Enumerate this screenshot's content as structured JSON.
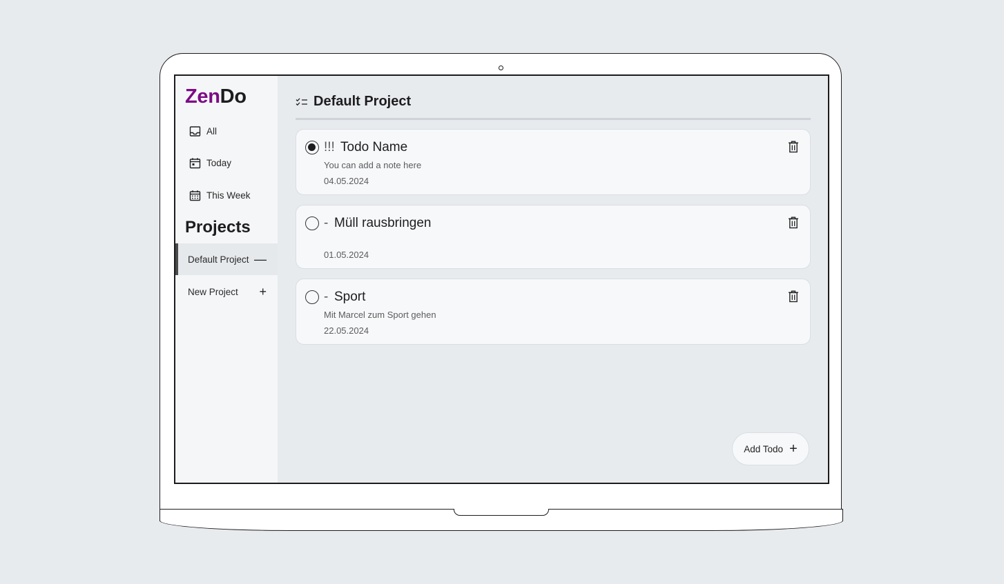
{
  "brand": {
    "part1": "Zen",
    "part2": "Do",
    "accent": "#7d0b86"
  },
  "nav": [
    {
      "label": "All",
      "icon": "inbox-icon"
    },
    {
      "label": "Today",
      "icon": "calendar-day-icon"
    },
    {
      "label": "This Week",
      "icon": "calendar-week-icon"
    }
  ],
  "projects": {
    "heading": "Projects",
    "items": [
      {
        "label": "Default Project",
        "action_symbol": "—",
        "active": true
      },
      {
        "label": "New Project",
        "action_symbol": "+",
        "active": false
      }
    ]
  },
  "main": {
    "title": "Default Project",
    "title_icon": "checklist-icon",
    "todos": [
      {
        "priority": "!!!",
        "name": "Todo Name",
        "note": "You can add a note here",
        "date": "04.05.2024",
        "selected": true
      },
      {
        "priority": "-",
        "name": "Müll rausbringen",
        "note": "",
        "date": "01.05.2024",
        "selected": false
      },
      {
        "priority": "-",
        "name": "Sport",
        "note": "Mit Marcel zum Sport gehen",
        "date": "22.05.2024",
        "selected": false
      }
    ],
    "add_button": {
      "label": "Add Todo",
      "symbol": "+"
    }
  }
}
